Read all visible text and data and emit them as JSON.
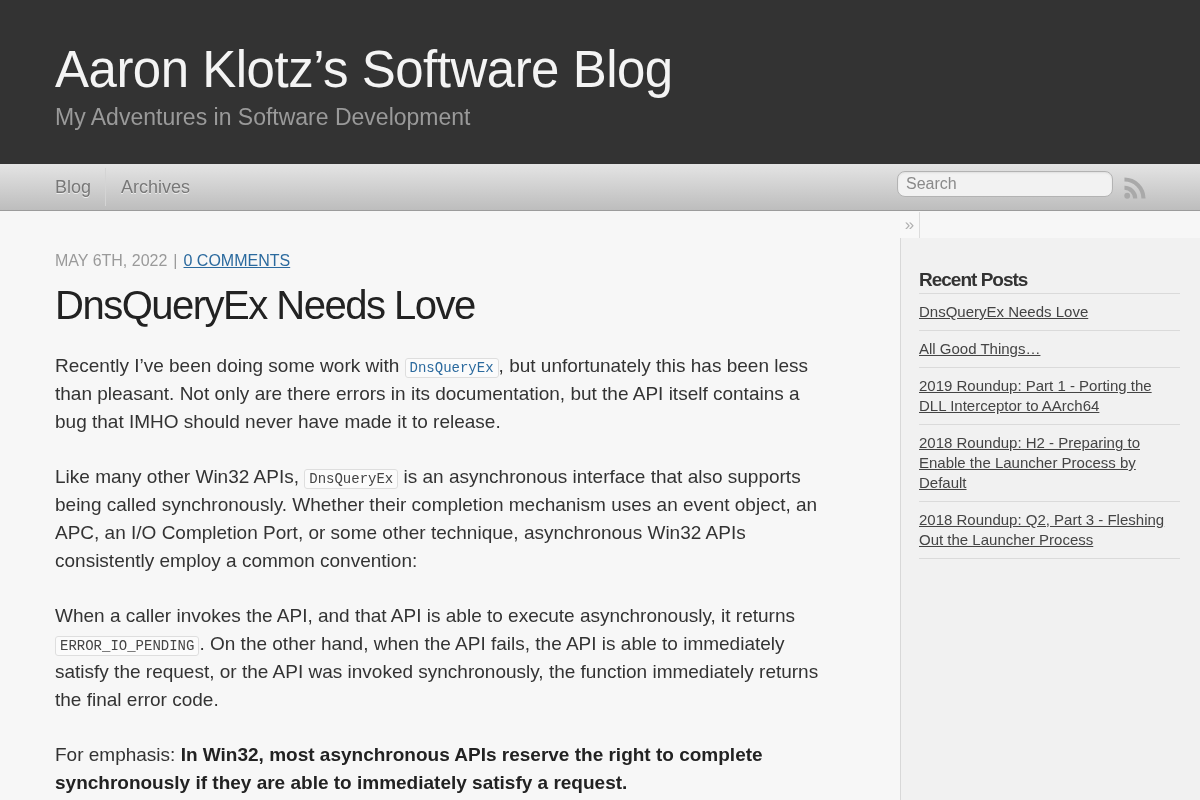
{
  "header": {
    "title": "Aaron Klotz’s Software Blog",
    "subtitle": "My Adventures in Software Development"
  },
  "nav": {
    "links": [
      {
        "label": "Blog"
      },
      {
        "label": "Archives"
      }
    ],
    "search": {
      "placeholder": "Search"
    }
  },
  "post": {
    "date": "MAY 6TH, 2022",
    "separator": "|",
    "comments": "0 COMMENTS",
    "title": "DnsQueryEx Needs Love",
    "paragraphs": [
      {
        "parts": [
          {
            "kind": "text",
            "text": "Recently I’ve been doing some work with "
          },
          {
            "kind": "codelink",
            "text": "DnsQueryEx"
          },
          {
            "kind": "text",
            "text": ", but unfortunately this has been less than pleasant. Not only are there errors in its documentation, but the API itself contains a bug that IMHO should never have made it to release."
          }
        ]
      },
      {
        "parts": [
          {
            "kind": "text",
            "text": "Like many other Win32 APIs, "
          },
          {
            "kind": "code",
            "text": "DnsQueryEx"
          },
          {
            "kind": "text",
            "text": " is an asynchronous interface that also supports being called synchronously. Whether their completion mechanism uses an event object, an APC, an I/O Completion Port, or some other technique, asynchronous Win32 APIs consistently employ a common convention:"
          }
        ]
      },
      {
        "parts": [
          {
            "kind": "text",
            "text": "When a caller invokes the API, and that API is able to execute asynchronously, it returns "
          },
          {
            "kind": "code",
            "text": "ERROR_IO_PENDING"
          },
          {
            "kind": "text",
            "text": ". On the other hand, when the API fails, the API is able to immediately satisfy the request, or the API was invoked synchronously, the function immediately returns the final error code."
          }
        ]
      },
      {
        "parts": [
          {
            "kind": "text",
            "text": "For emphasis: **In Win32, most asynchronous APIs reserve the right to complete synchronously if they are able to immediately satisfy a request.**"
          }
        ]
      }
    ]
  },
  "sidebar": {
    "toggle": "»",
    "heading": "Recent Posts",
    "posts": [
      {
        "title": "DnsQueryEx Needs Love"
      },
      {
        "title": "All Good Things…"
      },
      {
        "title": "2019 Roundup: Part 1 - Porting the DLL Interceptor to AArch64"
      },
      {
        "title": "2018 Roundup: H2 - Preparing to Enable the Launcher Process by Default"
      },
      {
        "title": "2018 Roundup: Q2, Part 3 - Fleshing Out the Launcher Process"
      }
    ]
  }
}
